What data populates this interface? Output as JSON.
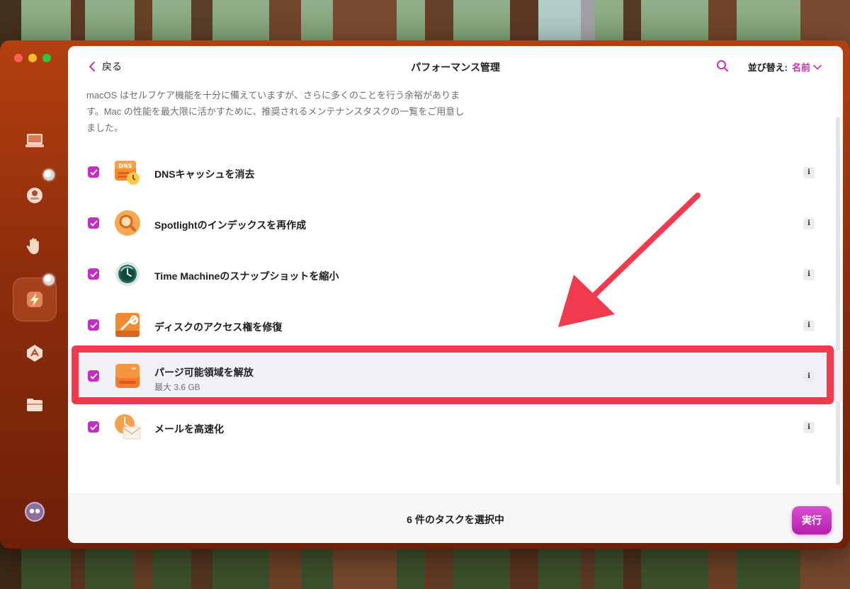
{
  "window": {
    "title": "パフォーマンス管理",
    "back_label": "戻る",
    "sort_label": "並び替え:",
    "sort_value": "名前"
  },
  "description": "macOS はセルフケア機能を十分に備えていますが、さらに多くのことを行う余裕があります。Mac の性能を最大限に活かすために、推奨されるメンテナンスタスクの一覧をご用意しました。",
  "sidebar": {
    "items": [
      {
        "icon": "laptop-icon"
      },
      {
        "icon": "shield-icon"
      },
      {
        "icon": "hand-icon"
      },
      {
        "icon": "lightning-icon",
        "active": true
      },
      {
        "icon": "apps-icon"
      },
      {
        "icon": "folder-icon"
      },
      {
        "icon": "assistant-icon"
      }
    ]
  },
  "tasks": [
    {
      "label": "DNSキャッシュを消去",
      "checked": true,
      "icon": "dns-clock-icon",
      "icon_text": "DNS"
    },
    {
      "label": "Spotlightのインデックスを再作成",
      "checked": true,
      "icon": "magnifier-icon"
    },
    {
      "label": "Time Machineのスナップショットを縮小",
      "checked": true,
      "icon": "time-machine-icon"
    },
    {
      "label": "ディスクのアクセス権を修復",
      "checked": true,
      "icon": "disk-wrench-icon"
    },
    {
      "label": "パージ可能領域を解放",
      "sub": "最大 3.6 GB",
      "checked": true,
      "icon": "drive-icon",
      "highlighted": true
    },
    {
      "label": "メールを高速化",
      "checked": true,
      "icon": "mail-speed-icon"
    }
  ],
  "info_label": "i",
  "footer": {
    "count_text": "6 件のタスクを選択中",
    "run_label": "実行"
  },
  "colors": {
    "accent": "#c52cc1",
    "annotation": "#f23a4e",
    "window_bg": "#b3400f"
  }
}
